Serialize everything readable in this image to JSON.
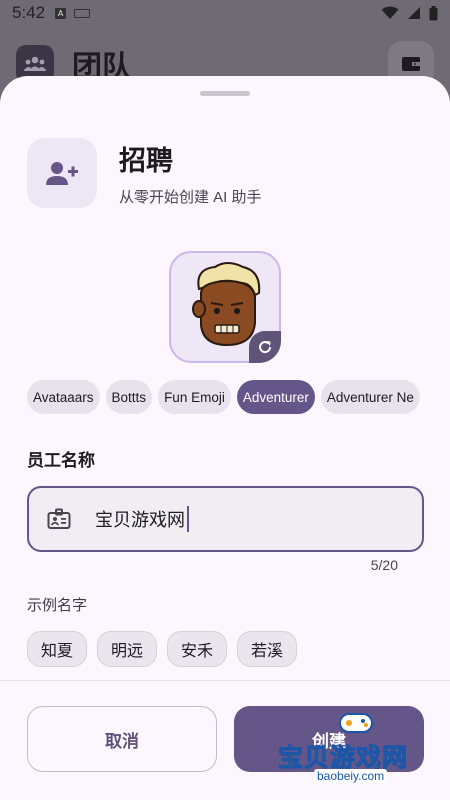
{
  "status_bar": {
    "time": "5:42",
    "notif_icon": "A"
  },
  "background": {
    "title": "团队",
    "team_icon": "group-icon",
    "wallet_icon": "wallet-icon"
  },
  "header": {
    "title": "招聘",
    "subtitle": "从零开始创建 AI 助手",
    "icon": "person-add-icon"
  },
  "avatar_styles": [
    {
      "label": "Avataaars",
      "selected": false
    },
    {
      "label": "Bottts",
      "selected": false
    },
    {
      "label": "Fun Emoji",
      "selected": false
    },
    {
      "label": "Adventurer",
      "selected": true
    },
    {
      "label": "Adventurer Ne",
      "selected": false
    }
  ],
  "name_field": {
    "label": "员工名称",
    "value": "宝贝游戏网",
    "counter": "5/20",
    "icon": "badge-icon"
  },
  "examples": {
    "label": "示例名字",
    "items": [
      "知夏",
      "明远",
      "安禾",
      "若溪"
    ]
  },
  "actions": {
    "cancel": "取消",
    "create": "创建"
  },
  "watermark": {
    "text": "宝贝游戏网",
    "url": "baobeiy.com"
  },
  "colors": {
    "primary": "#655689",
    "sheet_bg": "#fcf7ff",
    "chip_bg": "#e8e2ec"
  }
}
